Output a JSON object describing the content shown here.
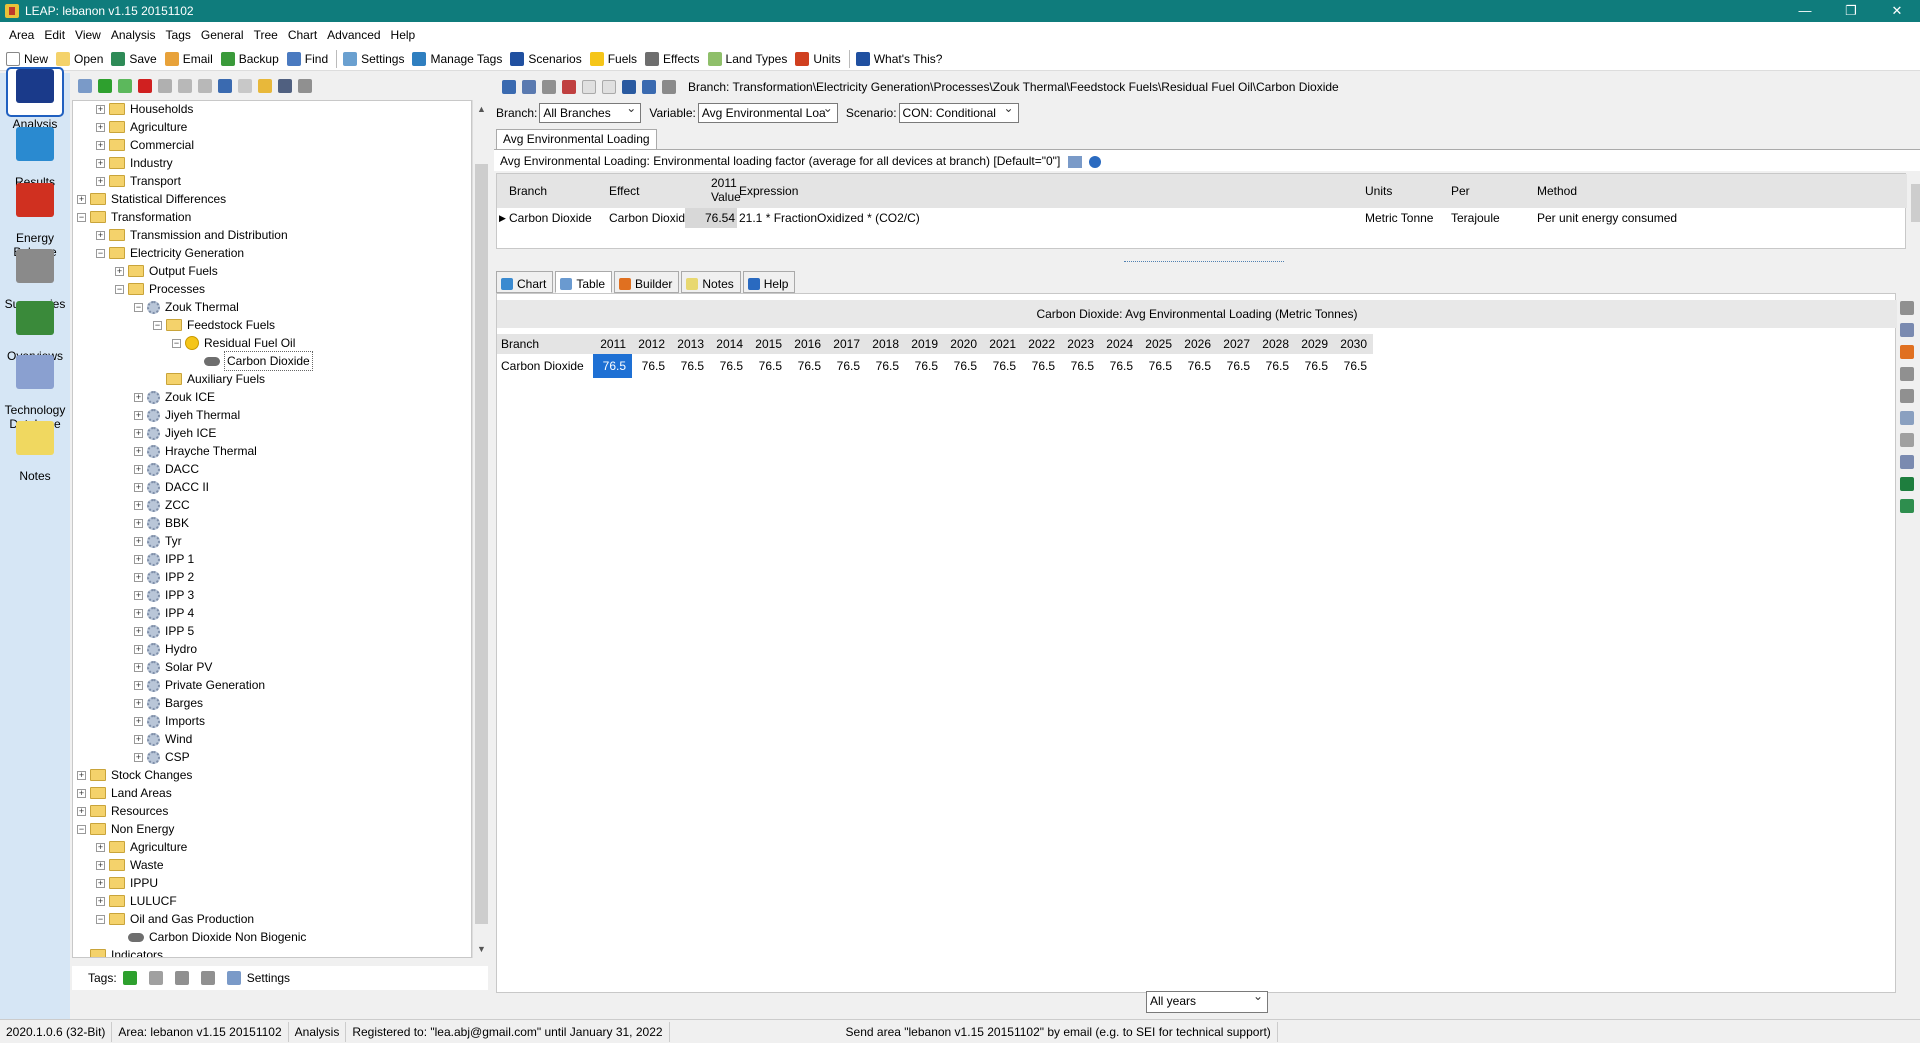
{
  "window": {
    "title": "LEAP: lebanon v1.15 20151102",
    "controls": [
      "—",
      "❐",
      "✕"
    ]
  },
  "menubar": [
    "Area",
    "Edit",
    "View",
    "Analysis",
    "Tags",
    "General",
    "Tree",
    "Chart",
    "Advanced",
    "Help"
  ],
  "toolbar": {
    "buttons": [
      {
        "label": "New",
        "icon": "new-icon",
        "color": "#ffffff"
      },
      {
        "label": "Open",
        "icon": "open-folder-icon",
        "color": "#f4d26b"
      },
      {
        "label": "Save",
        "icon": "save-icon",
        "color": "#2e8b57"
      },
      {
        "label": "Email",
        "icon": "email-icon",
        "color": "#e8a23a"
      },
      {
        "label": "Backup",
        "icon": "backup-icon",
        "color": "#3a9a3a"
      },
      {
        "label": "Find",
        "icon": "find-icon",
        "color": "#4a7ac0"
      }
    ],
    "buttons2": [
      {
        "label": "Settings",
        "icon": "settings-icon",
        "color": "#6aa0d0"
      },
      {
        "label": "Manage Tags",
        "icon": "tag-icon",
        "color": "#2f7fc0"
      },
      {
        "label": "Scenarios",
        "icon": "scenarios-icon",
        "color": "#2050a0"
      },
      {
        "label": "Fuels",
        "icon": "fuel-icon",
        "color": "#f5c518"
      },
      {
        "label": "Effects",
        "icon": "effects-icon",
        "color": "#6e6e6e"
      },
      {
        "label": "Land Types",
        "icon": "land-icon",
        "color": "#8fbf6a"
      },
      {
        "label": "Units",
        "icon": "units-icon",
        "color": "#d04020"
      }
    ],
    "help": {
      "label": "What's This?",
      "icon": "whats-this-icon",
      "color": "#2050a0"
    }
  },
  "rail": [
    {
      "label": "Analysis",
      "icon": "analysis-icon",
      "active": true
    },
    {
      "label": "Results",
      "icon": "results-icon"
    },
    {
      "label": "Energy\nBalance",
      "icon": "energy-balance-icon"
    },
    {
      "label": "Summaries",
      "icon": "summaries-icon"
    },
    {
      "label": "Overviews",
      "icon": "overviews-icon"
    },
    {
      "label": "Technology\nDatabase",
      "icon": "technology-database-icon"
    },
    {
      "label": "Notes",
      "icon": "notes-icon"
    }
  ],
  "tree": [
    {
      "label": "Households",
      "depth": 1,
      "icon": "folder",
      "exp": "+"
    },
    {
      "label": "Agriculture",
      "depth": 1,
      "icon": "folder",
      "exp": "+"
    },
    {
      "label": "Commercial",
      "depth": 1,
      "icon": "folder",
      "exp": "+"
    },
    {
      "label": "Industry",
      "depth": 1,
      "icon": "folder",
      "exp": "+"
    },
    {
      "label": "Transport",
      "depth": 1,
      "icon": "folder",
      "exp": "+"
    },
    {
      "label": "Statistical Differences",
      "depth": 0,
      "icon": "folder",
      "exp": "+"
    },
    {
      "label": "Transformation",
      "depth": 0,
      "icon": "folder",
      "exp": "−"
    },
    {
      "label": "Transmission and Distribution",
      "depth": 1,
      "icon": "folder",
      "exp": "+"
    },
    {
      "label": "Electricity Generation",
      "depth": 1,
      "icon": "folder",
      "exp": "−"
    },
    {
      "label": "Output Fuels",
      "depth": 2,
      "icon": "folder",
      "exp": "+"
    },
    {
      "label": "Processes",
      "depth": 2,
      "icon": "folder",
      "exp": "−"
    },
    {
      "label": "Zouk Thermal",
      "depth": 3,
      "icon": "gear",
      "exp": "−"
    },
    {
      "label": "Feedstock Fuels",
      "depth": 4,
      "icon": "folder",
      "exp": "−"
    },
    {
      "label": "Residual Fuel Oil",
      "depth": 5,
      "icon": "fuel",
      "exp": "−"
    },
    {
      "label": "Carbon Dioxide",
      "depth": 6,
      "icon": "cloud",
      "exp": "",
      "selected": true
    },
    {
      "label": "Auxiliary Fuels",
      "depth": 4,
      "icon": "folder",
      "exp": ""
    },
    {
      "label": "Zouk ICE",
      "depth": 3,
      "icon": "gear",
      "exp": "+"
    },
    {
      "label": "Jiyeh Thermal",
      "depth": 3,
      "icon": "gear",
      "exp": "+"
    },
    {
      "label": "Jiyeh ICE",
      "depth": 3,
      "icon": "gear",
      "exp": "+"
    },
    {
      "label": "Hrayche Thermal",
      "depth": 3,
      "icon": "gear",
      "exp": "+"
    },
    {
      "label": "DACC",
      "depth": 3,
      "icon": "gear",
      "exp": "+"
    },
    {
      "label": "DACC II",
      "depth": 3,
      "icon": "gear",
      "exp": "+"
    },
    {
      "label": "ZCC",
      "depth": 3,
      "icon": "gear",
      "exp": "+"
    },
    {
      "label": "BBK",
      "depth": 3,
      "icon": "gear",
      "exp": "+"
    },
    {
      "label": "Tyr",
      "depth": 3,
      "icon": "gear",
      "exp": "+"
    },
    {
      "label": "IPP 1",
      "depth": 3,
      "icon": "gear",
      "exp": "+"
    },
    {
      "label": "IPP 2",
      "depth": 3,
      "icon": "gear",
      "exp": "+"
    },
    {
      "label": "IPP 3",
      "depth": 3,
      "icon": "gear",
      "exp": "+"
    },
    {
      "label": "IPP 4",
      "depth": 3,
      "icon": "gear",
      "exp": "+"
    },
    {
      "label": "IPP 5",
      "depth": 3,
      "icon": "gear",
      "exp": "+"
    },
    {
      "label": "Hydro",
      "depth": 3,
      "icon": "gear",
      "exp": "+"
    },
    {
      "label": "Solar PV",
      "depth": 3,
      "icon": "gear",
      "exp": "+"
    },
    {
      "label": "Private Generation",
      "depth": 3,
      "icon": "gear",
      "exp": "+"
    },
    {
      "label": "Barges",
      "depth": 3,
      "icon": "gear",
      "exp": "+"
    },
    {
      "label": "Imports",
      "depth": 3,
      "icon": "gear",
      "exp": "+"
    },
    {
      "label": "Wind",
      "depth": 3,
      "icon": "gear",
      "exp": "+"
    },
    {
      "label": "CSP",
      "depth": 3,
      "icon": "gear",
      "exp": "+"
    },
    {
      "label": "Stock Changes",
      "depth": 0,
      "icon": "folder",
      "exp": "+"
    },
    {
      "label": "Land Areas",
      "depth": 0,
      "icon": "folder",
      "exp": "+"
    },
    {
      "label": "Resources",
      "depth": 0,
      "icon": "folder",
      "exp": "+"
    },
    {
      "label": "Non Energy",
      "depth": 0,
      "icon": "folder",
      "exp": "−"
    },
    {
      "label": "Agriculture",
      "depth": 1,
      "icon": "folder",
      "exp": "+"
    },
    {
      "label": "Waste",
      "depth": 1,
      "icon": "folder",
      "exp": "+"
    },
    {
      "label": "IPPU",
      "depth": 1,
      "icon": "folder",
      "exp": "+"
    },
    {
      "label": "LULUCF",
      "depth": 1,
      "icon": "folder",
      "exp": "+"
    },
    {
      "label": "Oil and Gas Production",
      "depth": 1,
      "icon": "folder",
      "exp": "−"
    },
    {
      "label": "Carbon Dioxide Non Biogenic",
      "depth": 2,
      "icon": "cloud",
      "exp": ""
    },
    {
      "label": "Indicators",
      "depth": 0,
      "icon": "folder",
      "exp": ""
    }
  ],
  "tags": {
    "label": "Tags:",
    "settings_label": "Settings"
  },
  "breadcrumb": "Branch: Transformation\\Electricity Generation\\Processes\\Zouk Thermal\\Feedstock Fuels\\Residual Fuel Oil\\Carbon Dioxide",
  "selectors": {
    "branch_label": "Branch:",
    "branch_value": "All Branches",
    "variable_label": "Variable:",
    "variable_value": "Avg Environmental Loa",
    "scenario_label": "Scenario:",
    "scenario_value": "CON: Conditional"
  },
  "variable_tab": "Avg Environmental Loading",
  "variable_description": "Avg Environmental Loading: Environmental loading factor (average for all devices at branch) [Default=\"0\"]",
  "expression_grid": {
    "headers": {
      "branch": "Branch",
      "effect": "Effect",
      "value_year": "2011",
      "value": "Value",
      "expression": "Expression",
      "units": "Units",
      "per": "Per",
      "method": "Method"
    },
    "row": {
      "branch": "Carbon Dioxide",
      "effect": "Carbon Dioxide...",
      "value": "76.54",
      "expression": "21.1 * FractionOxidized * (CO2/C)",
      "units": "Metric Tonne",
      "per": "Terajoule",
      "method": "Per unit energy consumed"
    }
  },
  "view_tabs": [
    {
      "label": "Chart",
      "icon": "chart-tab-icon",
      "color": "#3a8ad0"
    },
    {
      "label": "Table",
      "icon": "table-tab-icon",
      "color": "#6a9ad0",
      "active": true
    },
    {
      "label": "Builder",
      "icon": "builder-tab-icon",
      "color": "#e07020"
    },
    {
      "label": "Notes",
      "icon": "notes-tab-icon",
      "color": "#e8d870"
    },
    {
      "label": "Help",
      "icon": "help-tab-icon",
      "color": "#2a6ac0"
    }
  ],
  "result_table": {
    "title": "Carbon Dioxide: Avg Environmental Loading (Metric Tonnes)",
    "branch_header": "Branch",
    "years": [
      "2011",
      "2012",
      "2013",
      "2014",
      "2015",
      "2016",
      "2017",
      "2018",
      "2019",
      "2020",
      "2021",
      "2022",
      "2023",
      "2024",
      "2025",
      "2026",
      "2027",
      "2028",
      "2029",
      "2030"
    ],
    "rows": [
      {
        "branch": "Carbon Dioxide",
        "values": [
          "76.5",
          "76.5",
          "76.5",
          "76.5",
          "76.5",
          "76.5",
          "76.5",
          "76.5",
          "76.5",
          "76.5",
          "76.5",
          "76.5",
          "76.5",
          "76.5",
          "76.5",
          "76.5",
          "76.5",
          "76.5",
          "76.5",
          "76.5"
        ]
      }
    ]
  },
  "years_filter": "All years",
  "statusbar": [
    "2020.1.0.6 (32-Bit)",
    "Area: lebanon v1.15 20151102",
    "Analysis",
    "Registered to: \"lea.abj@gmail.com\" until January 31, 2022",
    "Send area \"lebanon v1.15 20151102\" by email (e.g. to SEI for technical support)"
  ]
}
